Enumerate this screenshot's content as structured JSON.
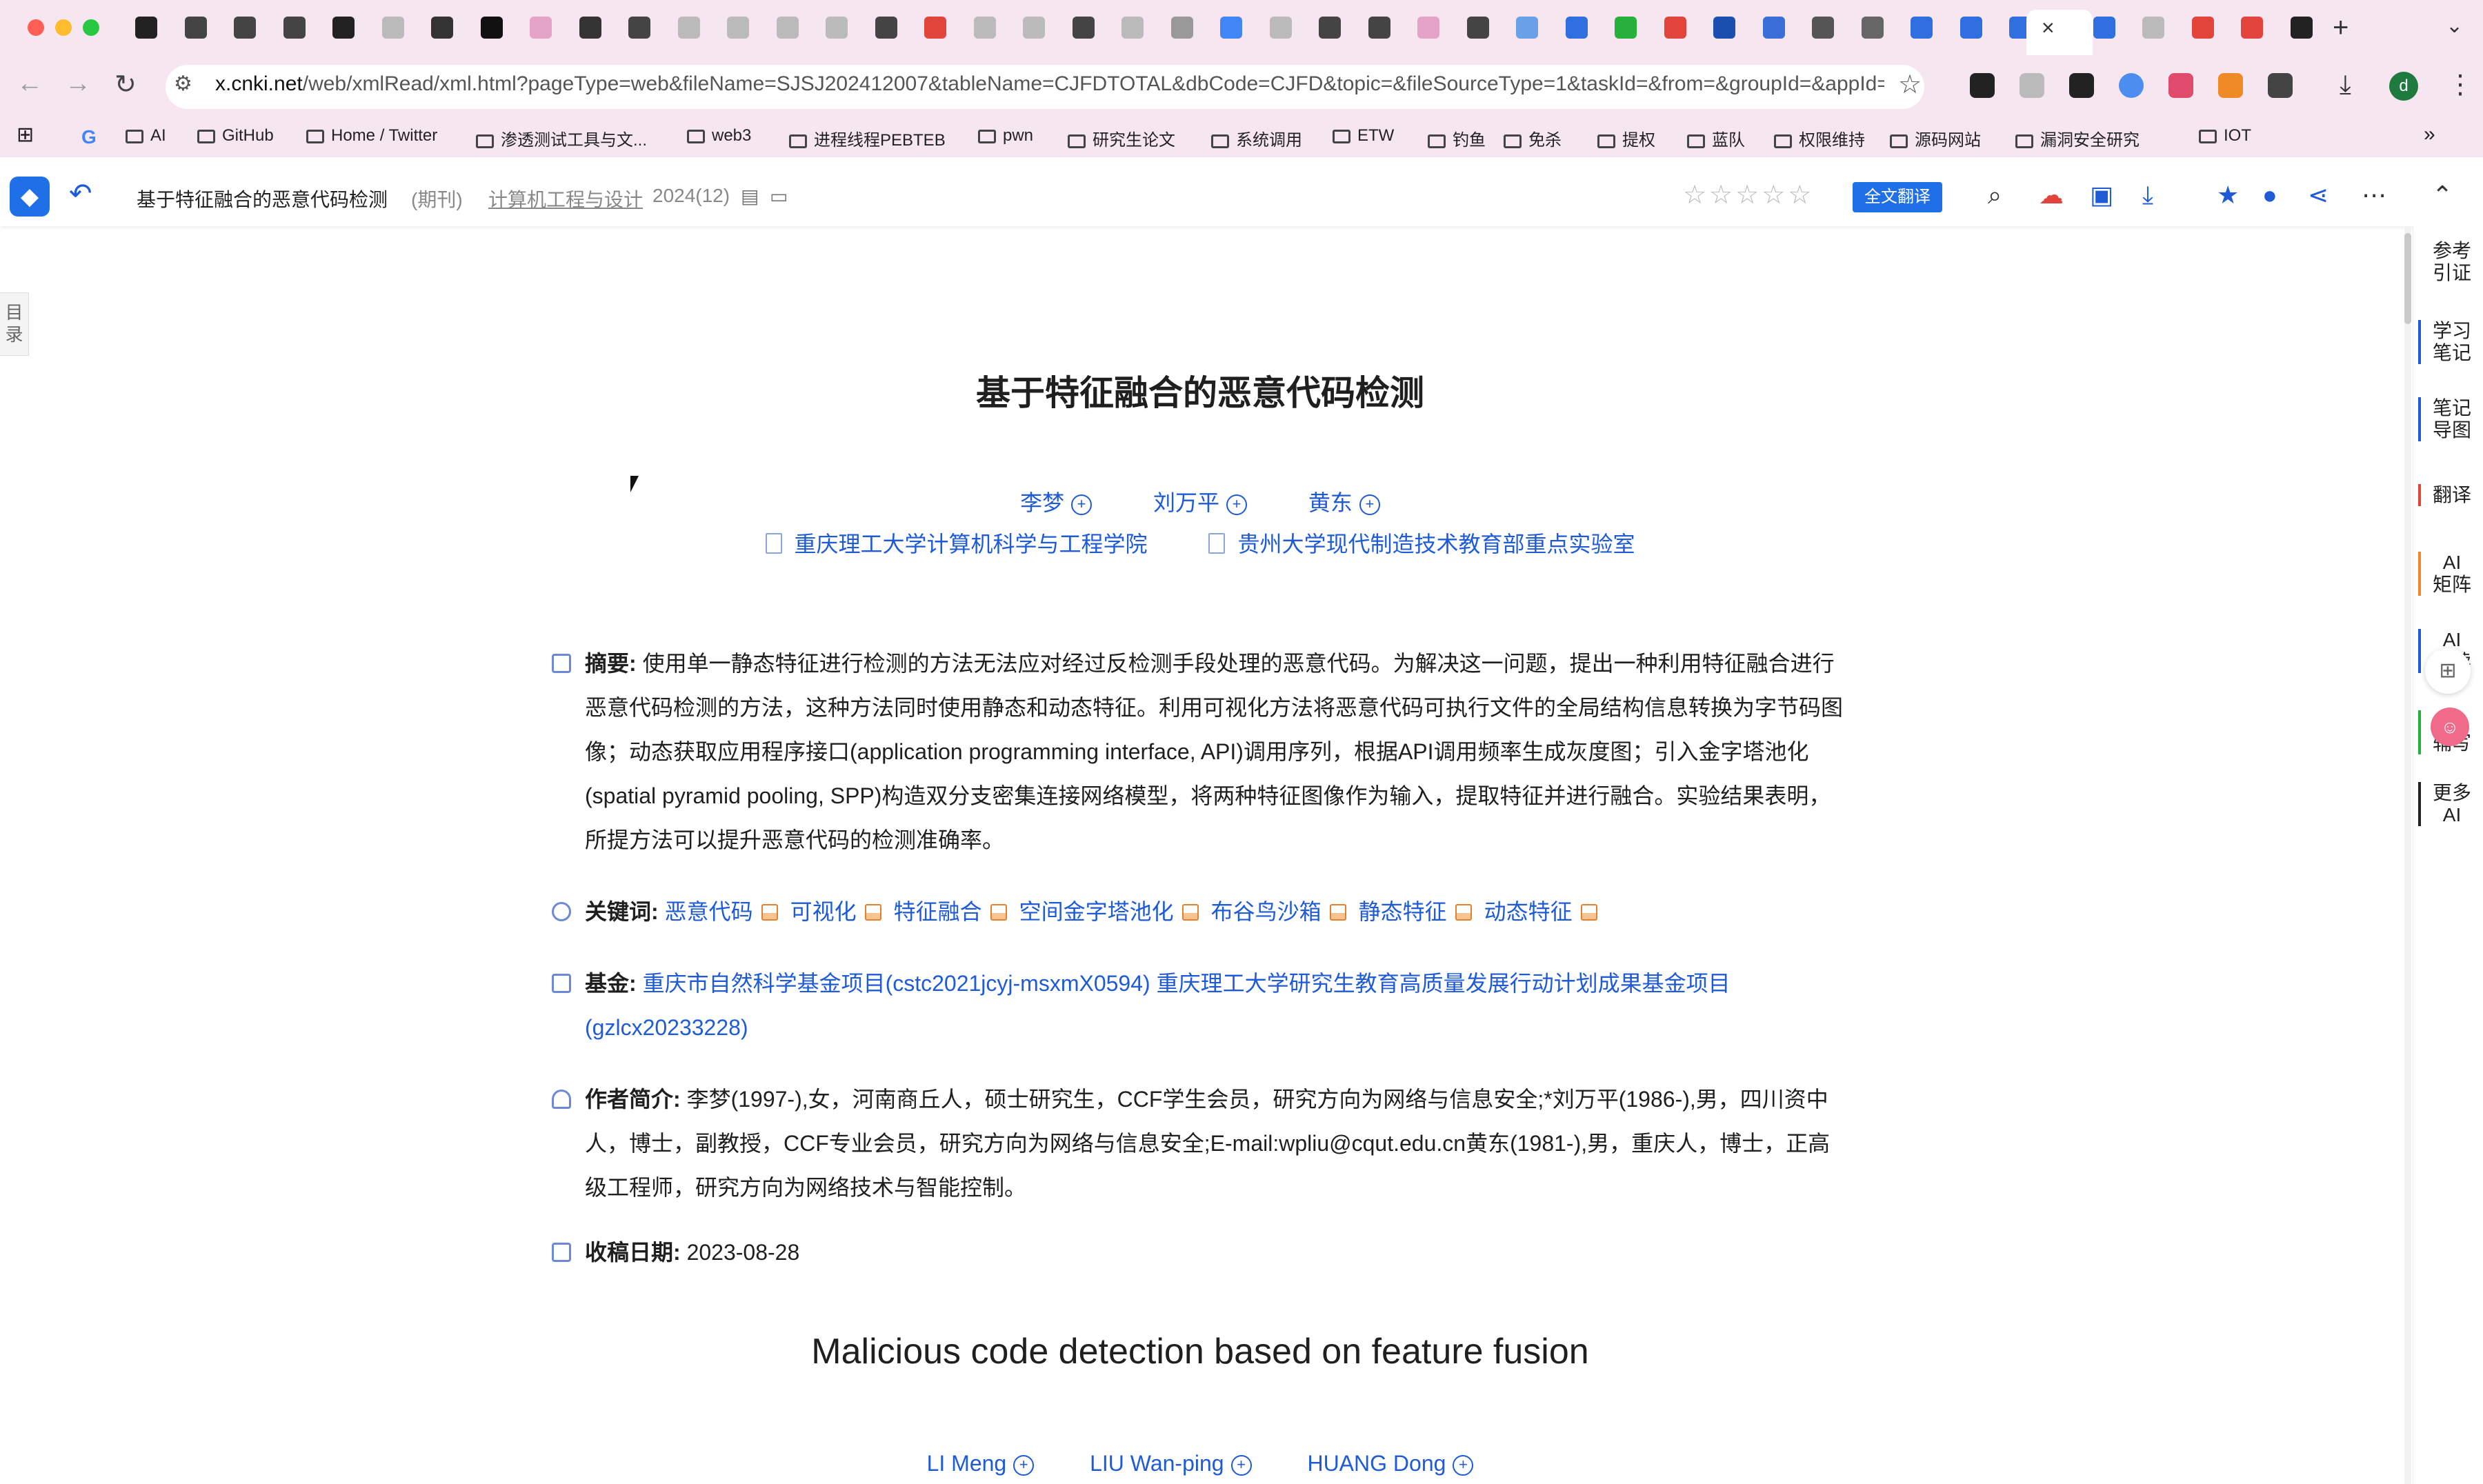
{
  "browser": {
    "url_host": "x.cnki.net",
    "url_rest": "/web/xmlRead/xml.html?pageType=web&fileName=SJSJ202412007&tableName=CJFDTOTAL&dbCode=CJFD&topic=&fileSourceType=1&taskId=&from=&groupId=&appId=...",
    "profile_initial": "d",
    "tab_close": "×",
    "new_tab": "+",
    "tab_menu": "⌄",
    "colors": {
      "chrome_bg": "#f6e6f0",
      "accent": "#1f5bd6"
    }
  },
  "bookmarks": [
    {
      "label": "G",
      "type": "icon"
    },
    {
      "label": "AI"
    },
    {
      "label": "GitHub"
    },
    {
      "label": "Home / Twitter"
    },
    {
      "label": "渗透测试工具与文..."
    },
    {
      "label": "web3"
    },
    {
      "label": "进程线程PEBTEB"
    },
    {
      "label": "pwn"
    },
    {
      "label": "研究生论文"
    },
    {
      "label": "系统调用"
    },
    {
      "label": "ETW"
    },
    {
      "label": "钓鱼"
    },
    {
      "label": "免杀"
    },
    {
      "label": "提权"
    },
    {
      "label": "蓝队"
    },
    {
      "label": "权限维持"
    },
    {
      "label": "源码网站"
    },
    {
      "label": "漏洞安全研究"
    },
    {
      "label": "IOT"
    }
  ],
  "reader": {
    "title": "基于特征融合的恶意代码检测",
    "type": "(期刊)",
    "journal": "计算机工程与设计",
    "issue": "2024(12)",
    "translate_label": "全文翻译",
    "stars": "☆☆☆☆☆",
    "toc_label": "目录"
  },
  "side_rail": [
    {
      "label": "参考引证"
    },
    {
      "label": "学习笔记"
    },
    {
      "label": "笔记导图"
    },
    {
      "label": "翻译"
    },
    {
      "label": "AI矩阵"
    },
    {
      "label": "AI研读"
    },
    {
      "label": "AI辅写"
    },
    {
      "label": "更多AI"
    }
  ],
  "article": {
    "title": "基于特征融合的恶意代码检测",
    "authors": [
      "李梦",
      "刘万平",
      "黄东"
    ],
    "affiliations": [
      "重庆理工大学计算机科学与工程学院",
      "贵州大学现代制造技术教育部重点实验室"
    ],
    "abstract_label": "摘要:",
    "abstract": "使用单一静态特征进行检测的方法无法应对经过反检测手段处理的恶意代码。为解决这一问题，提出一种利用特征融合进行恶意代码检测的方法，这种方法同时使用静态和动态特征。利用可视化方法将恶意代码可执行文件的全局结构信息转换为字节码图像；动态获取应用程序接口(application programming interface, API)调用序列，根据API调用频率生成灰度图；引入金字塔池化(spatial pyramid pooling, SPP)构造双分支密集连接网络模型，将两种特征图像作为输入，提取特征并进行融合。实验结果表明，所提方法可以提升恶意代码的检测准确率。",
    "keywords_label": "关键词:",
    "keywords": [
      "恶意代码",
      "可视化",
      "特征融合",
      "空间金字塔池化",
      "布谷鸟沙箱",
      "静态特征",
      "动态特征"
    ],
    "fund_label": "基金:",
    "fund": "重庆市自然科学基金项目(cstc2021jcyj-msxmX0594) 重庆理工大学研究生教育高质量发展行动计划成果基金项目(gzlcx20233228)",
    "bio_label": "作者简介:",
    "bio": "李梦(1997-),女，河南商丘人，硕士研究生，CCF学生会员，研究方向为网络与信息安全;*刘万平(1986-),男，四川资中人，博士，副教授，CCF专业会员，研究方向为网络与信息安全;E-mail:wpliu@cqut.edu.cn黄东(1981-),男，重庆人，博士，正高级工程师，研究方向为网络技术与智能控制。",
    "date_label": "收稿日期:",
    "date": "2023-08-28",
    "en_title": "Malicious code detection based on feature fusion",
    "en_authors": [
      "LI Meng",
      "LIU Wan-ping",
      "HUANG Dong"
    ]
  }
}
